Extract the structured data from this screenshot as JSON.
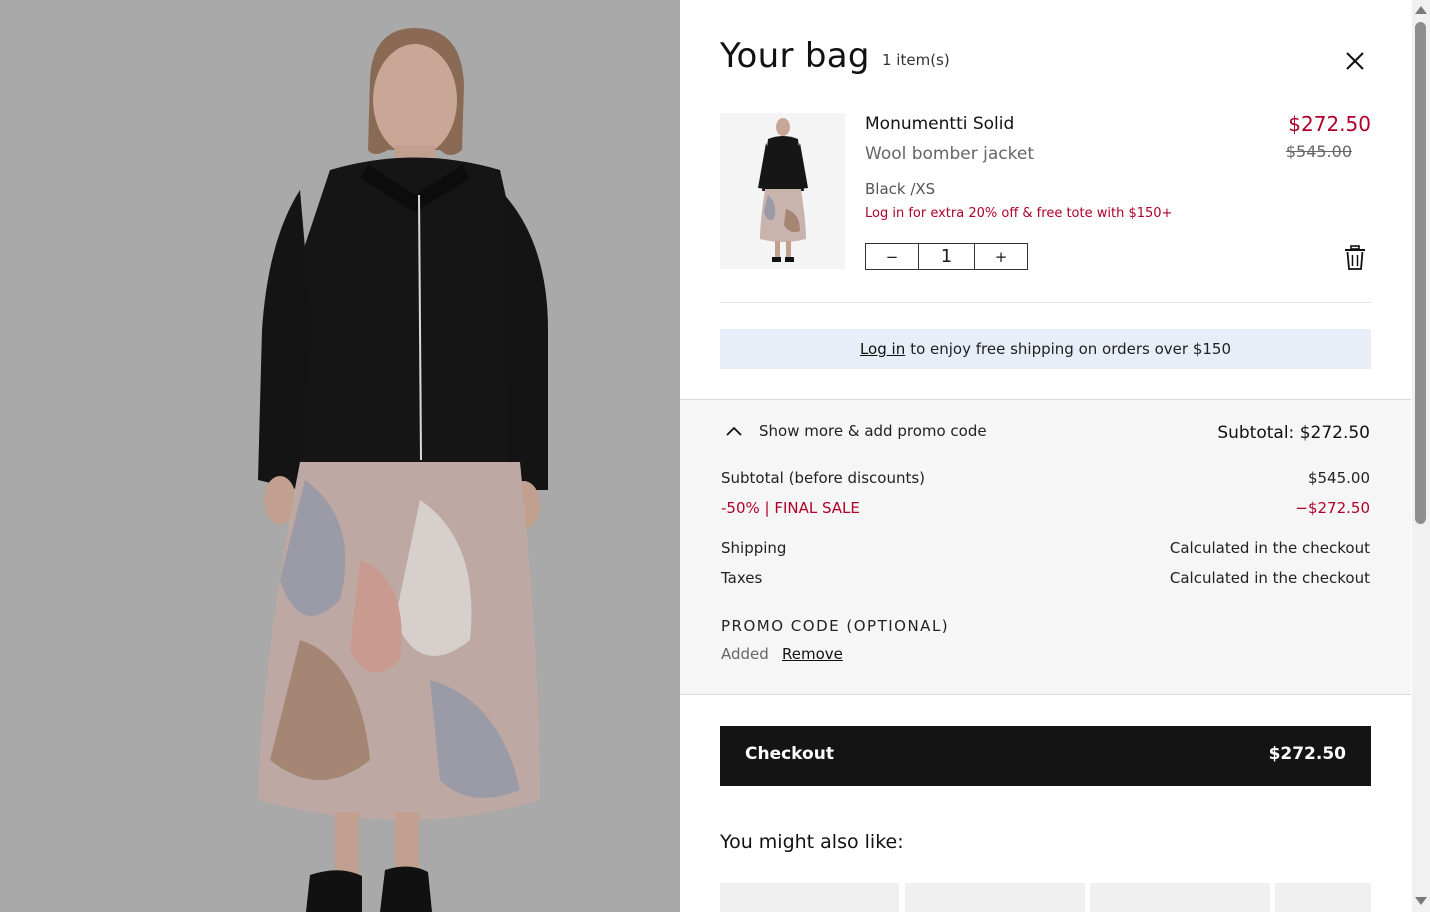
{
  "bag": {
    "title": "Your bag",
    "count": "1 item(s)"
  },
  "item": {
    "name": "Monumentti Solid",
    "subtitle": "Wool bomber jacket",
    "variant": "Black /XS",
    "promo": "Log in for extra 20% off & free tote with $150+",
    "price": "$272.50",
    "original_price": "$545.00",
    "qty_minus": "−",
    "qty": "1",
    "qty_plus": "+"
  },
  "shipping_banner": {
    "link": "Log in",
    "text": "to enjoy free shipping on orders over $150"
  },
  "summary": {
    "toggle_label": "Show more & add promo code",
    "subtotal": "Subtotal: $272.50",
    "rows": [
      {
        "label": "Subtotal (before discounts)",
        "value": "$545.00"
      },
      {
        "label": "-50% | FINAL SALE",
        "value": "−$272.50"
      },
      {
        "label": "Shipping",
        "value": "Calculated in the checkout"
      },
      {
        "label": "Taxes",
        "value": "Calculated in the checkout"
      }
    ],
    "promo_label": "PROMO CODE (OPTIONAL)",
    "promo_status": "Added",
    "promo_remove": "Remove"
  },
  "checkout": {
    "label": "Checkout",
    "amount": "$272.50"
  },
  "recommendations": {
    "title": "You might also like:"
  },
  "colors": {
    "accent_red": "#b0002a",
    "checkout_bg": "#141414",
    "banner_bg": "#e8eef7",
    "summary_bg": "#f6f6f6"
  },
  "icons": {
    "close": "close-icon",
    "delete": "trash-icon",
    "toggle": "chevron-up-icon"
  }
}
